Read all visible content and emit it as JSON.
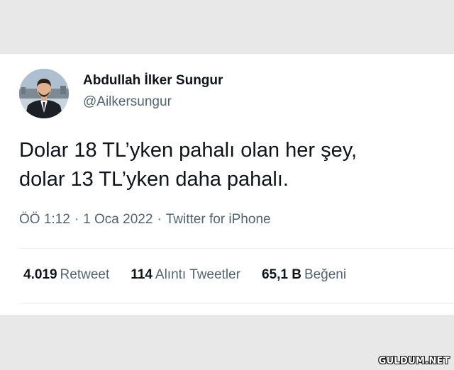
{
  "tweet": {
    "display_name": "Abdullah İlker Sungur",
    "handle": "@Ailkersungur",
    "text_lines": [
      "Dolar 18 TL’yken pahalı olan her şey,",
      "dolar 13 TL’yken daha pahalı."
    ],
    "time": "ÖÖ 1:12",
    "date": "1 Oca 2022",
    "source": "Twitter for iPhone",
    "separator": "·"
  },
  "stats": [
    {
      "count": "4.019",
      "label": "Retweet"
    },
    {
      "count": "114",
      "label": "Alıntı Tweetler"
    },
    {
      "count": "65,1 B",
      "label": "Beğeni"
    }
  ],
  "watermark": "GULDUM.NET",
  "colors": {
    "page_background": "#e8e8e9",
    "card_background": "#ffffff",
    "primary_text": "#0f1419",
    "secondary_text": "#536471",
    "divider": "#eff3f4"
  },
  "icons": {
    "avatar": "profile-photo-man-in-suit"
  }
}
